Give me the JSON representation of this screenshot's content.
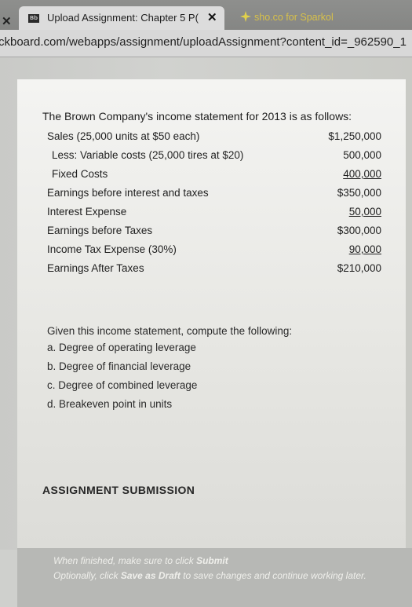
{
  "browser": {
    "close_glyph": "✕",
    "active_tab": {
      "favicon_text": "Bb",
      "title": "Upload Assignment: Chapter 5 P(",
      "close_glyph": "✕"
    },
    "inactive_tab": {
      "icon": "sparkol-icon",
      "title": "sho.co for Sparkol"
    },
    "url": "ckboard.com/webapps/assignment/uploadAssignment?content_id=_962590_1"
  },
  "question": {
    "title": "The Brown Company's income statement for 2013 is as follows:",
    "rows": [
      {
        "label": "Sales (25,000 units at $50 each)",
        "value": "$1,250,000"
      },
      {
        "label": "Less: Variable costs (25,000 tires at $20)",
        "value": "500,000"
      },
      {
        "label": "Fixed Costs",
        "value": "400,000"
      },
      {
        "label": "Earnings before interest and taxes",
        "value": "$350,000"
      },
      {
        "label": "Interest Expense",
        "value": "50,000"
      },
      {
        "label": "Earnings before Taxes",
        "value": "$300,000"
      },
      {
        "label": "Income Tax Expense (30%)",
        "value": "90,000"
      },
      {
        "label": "Earnings After Taxes",
        "value": "$210,000"
      }
    ],
    "instructions_intro": "Given this income statement, compute the following:",
    "tasks": [
      "a. Degree of operating leverage",
      "b. Degree of financial leverage",
      "c. Degree of combined leverage",
      "d. Breakeven point in units"
    ]
  },
  "submission": {
    "heading": "ASSIGNMENT SUBMISSION",
    "note_line1_prefix": "When finished, make sure to click ",
    "note_line1_action": "Submit",
    "note_line2_prefix": "Optionally, click ",
    "note_line2_action": "Save as Draft",
    "note_line2_suffix": " to save changes and continue working later."
  }
}
